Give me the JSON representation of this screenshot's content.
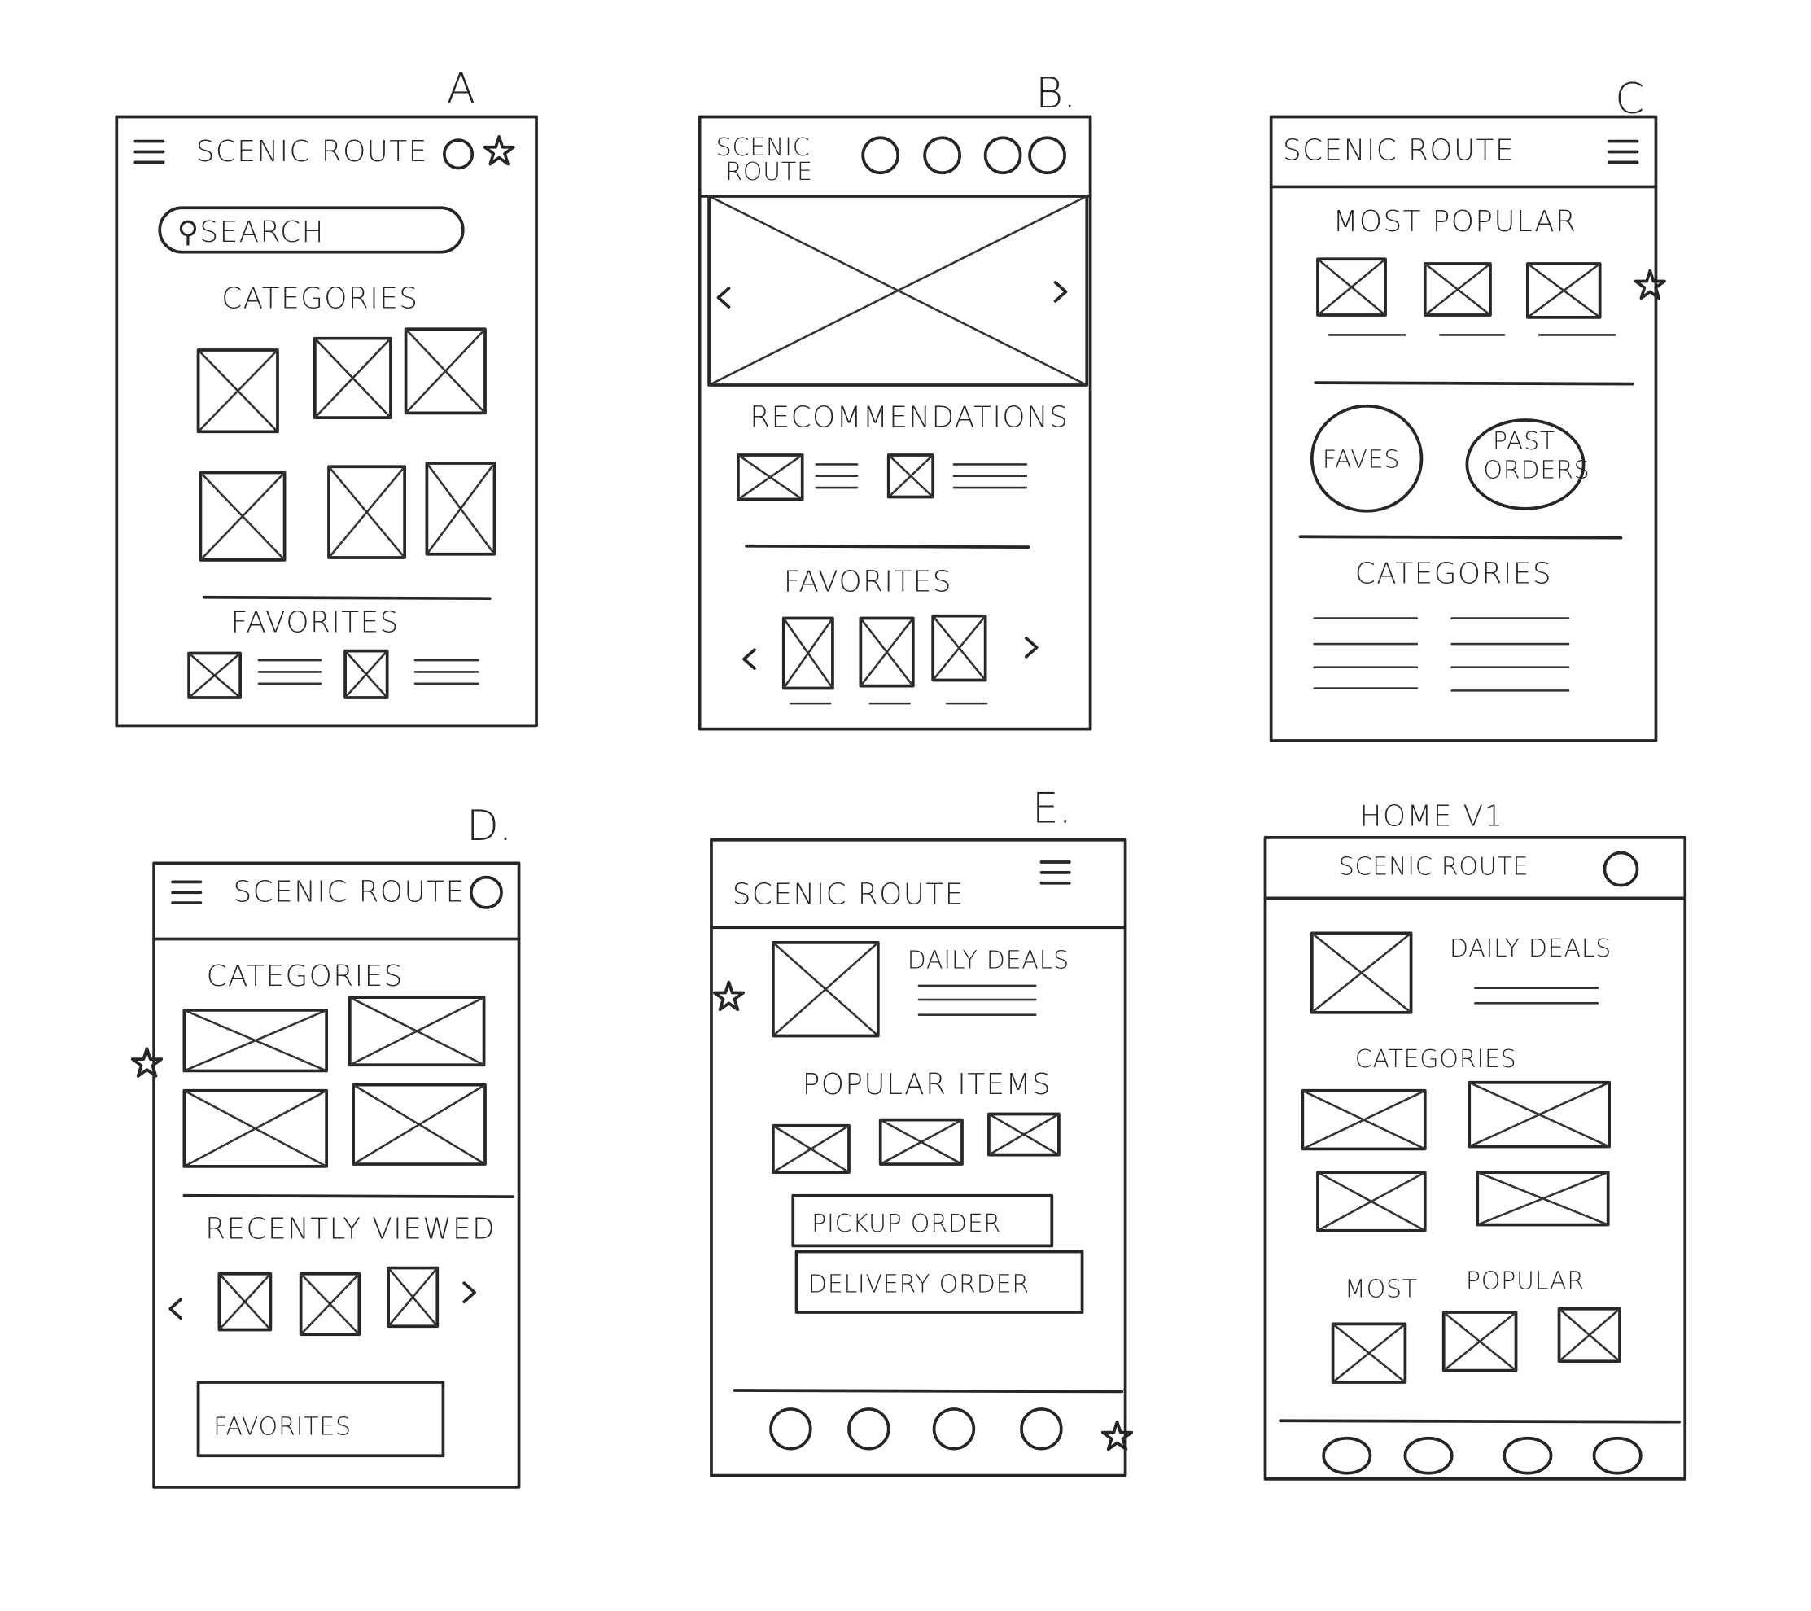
{
  "sketches": {
    "a": {
      "label": "A",
      "title": "SCENIC ROUTE",
      "search": "⚲SEARCH",
      "categories": "CATEGORIES",
      "favorites": "FAVORITES"
    },
    "b": {
      "label": "B.",
      "title_line1": "SCENIC",
      "title_line2": "ROUTE",
      "recommendations": "RECOMMENDATIONS",
      "favorites": "FAVORITES",
      "prev": "‹",
      "next": "›"
    },
    "c": {
      "label": "C",
      "title": "SCENIC ROUTE",
      "most_popular": "MOST POPULAR",
      "faves": "FAVES",
      "past_line1": "PAST",
      "past_line2": "ORDERS",
      "categories": "CATEGORIES"
    },
    "d": {
      "label": "D.",
      "title": "SCENIC ROUTE",
      "categories": "CATEGORIES",
      "recently_viewed": "RECENTLY VIEWED",
      "favorites_button": "FAVORITES",
      "prev": "‹",
      "next": "›"
    },
    "e": {
      "label": "E.",
      "title": "SCENIC ROUTE",
      "daily_deals": "DAILY DEALS",
      "popular_items": "POPULAR ITEMS",
      "pickup_button": "PICKUP ORDER",
      "delivery_button": "DELIVERY ORDER"
    },
    "home": {
      "label": "HOME V1",
      "title": "SCENIC ROUTE",
      "daily_deals": "DAILY DEALS",
      "categories": "CATEGORIES",
      "most": "MOST",
      "popular": "POPULAR"
    }
  }
}
